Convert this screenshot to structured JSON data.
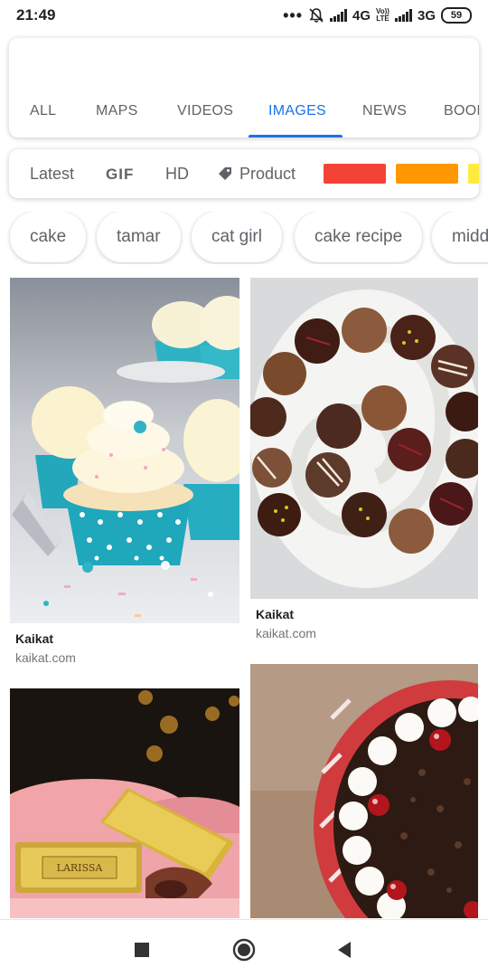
{
  "status_bar": {
    "time": "21:49",
    "network_1": "4G",
    "volte_top": "Vo))",
    "volte_bottom": "LTE",
    "network_2": "3G",
    "battery": "59"
  },
  "tabs": [
    {
      "label": "ALL"
    },
    {
      "label": "MAPS"
    },
    {
      "label": "VIDEOS"
    },
    {
      "label": "IMAGES"
    },
    {
      "label": "NEWS"
    },
    {
      "label": "BOOKS"
    }
  ],
  "filters": {
    "latest": "Latest",
    "gif": "GIF",
    "hd": "HD",
    "product": "Product",
    "colors": [
      "#f44336",
      "#ff9800",
      "#ffeb3b"
    ]
  },
  "chips": [
    {
      "label": "cake"
    },
    {
      "label": "tamar"
    },
    {
      "label": "cat girl"
    },
    {
      "label": "cake recipe"
    },
    {
      "label": "middle"
    }
  ],
  "results": [
    {
      "title": "Kaikat",
      "domain": "kaikat.com",
      "image": "blue-polka-dot-cupcakes-photo"
    },
    {
      "title": "Kaikat",
      "domain": "kaikat.com",
      "image": "chocolate-truffles-spiral-plate-photo"
    },
    {
      "title": "",
      "domain": "",
      "image": "larissa-gold-wrapped-chocolates-photo"
    },
    {
      "title": "",
      "domain": "",
      "image": "black-forest-cake-cherries-photo"
    }
  ],
  "nav": {
    "recents": "square-recents-icon",
    "home": "circle-home-icon",
    "back": "triangle-back-icon"
  },
  "accent_color": "#1a73e8"
}
